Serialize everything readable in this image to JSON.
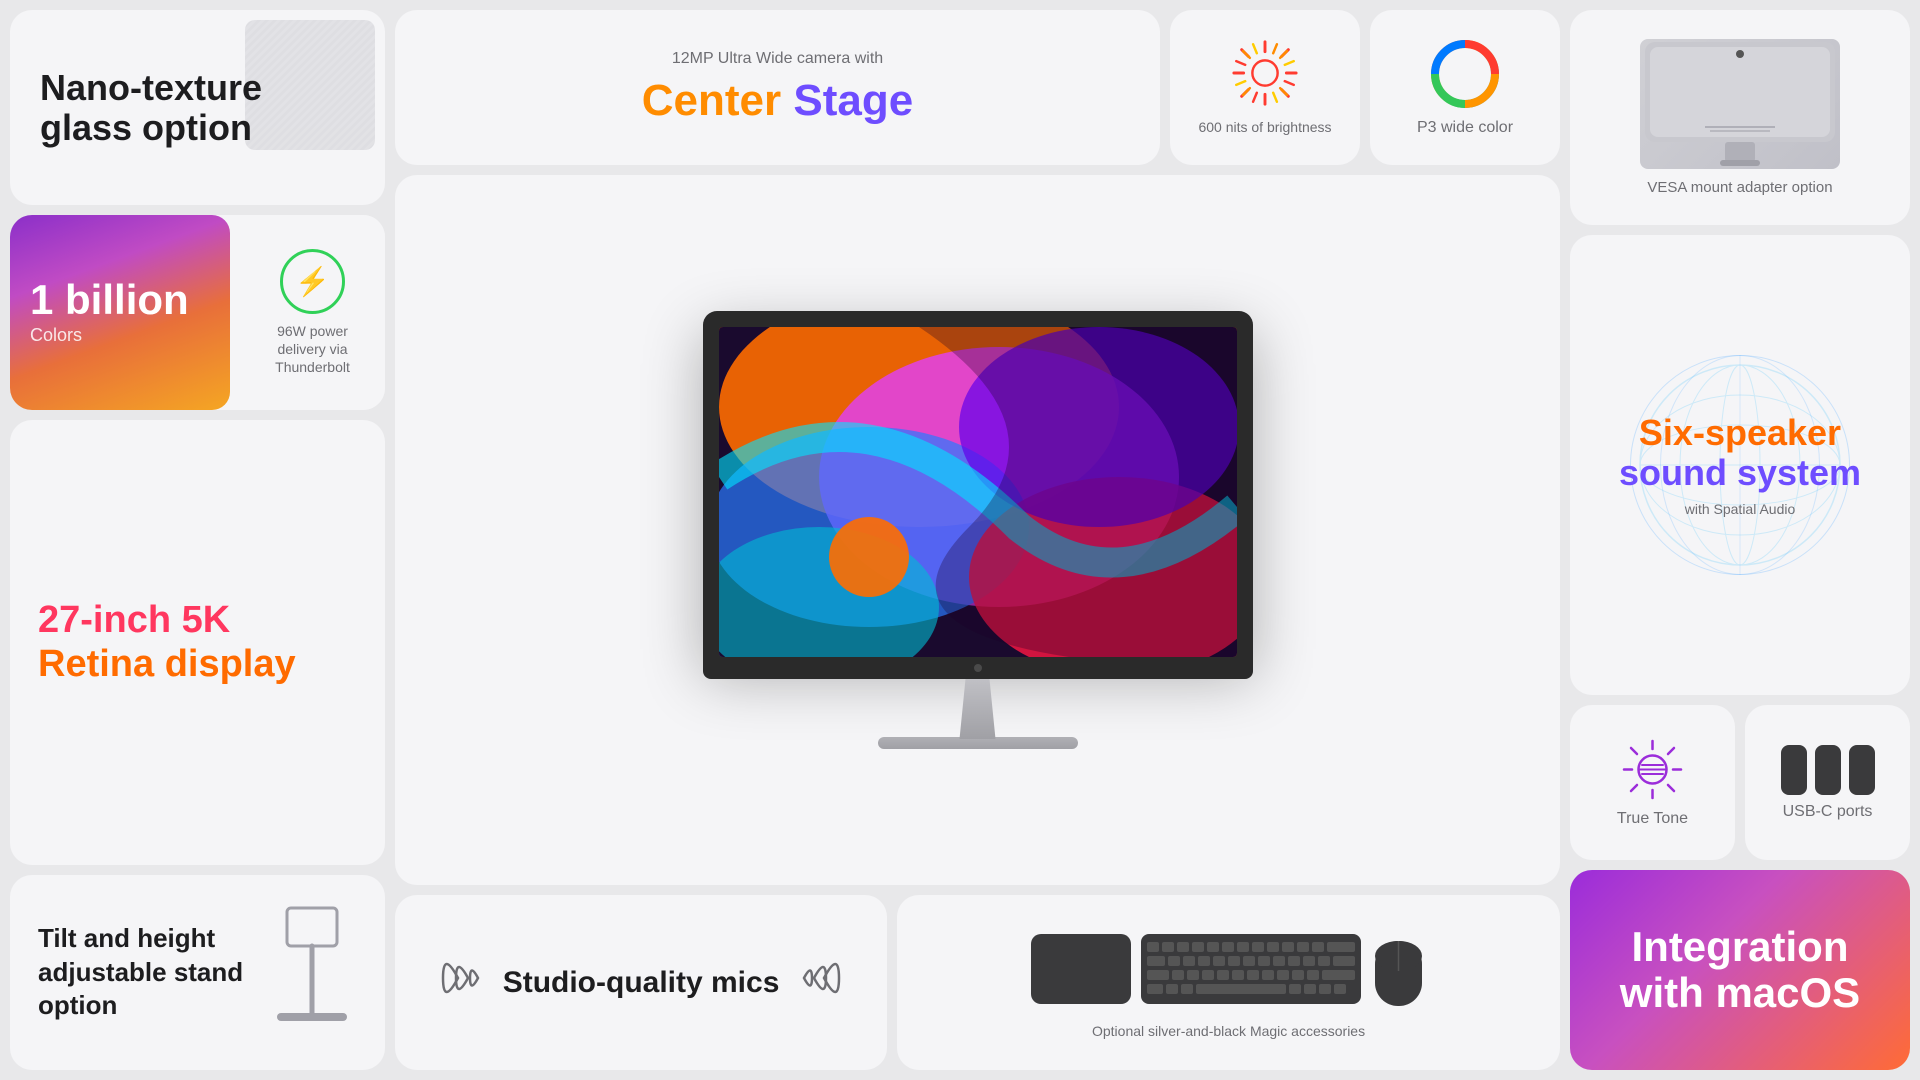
{
  "left": {
    "nano_texture": {
      "title": "Nano-texture glass option"
    },
    "billion": {
      "number": "1 billion",
      "label": "Colors",
      "power": "96W power delivery via Thunderbolt"
    },
    "retina": {
      "line1": "27-inch 5K",
      "line2": "Retina display"
    },
    "tilt": {
      "text": "Tilt and height adjustable stand option"
    }
  },
  "center": {
    "top": {
      "camera_label": "12MP Ultra Wide camera with",
      "center_stage": "Center Stage",
      "center": "Center",
      "stage": "Stage",
      "brightness": "600 nits of brightness",
      "p3": "P3 wide color"
    },
    "bottom": {
      "studio_mics": "Studio-quality mics",
      "accessories": "Optional silver-and-black Magic accessories"
    }
  },
  "right": {
    "vesa": {
      "text": "VESA mount adapter option"
    },
    "six_speaker": {
      "title_line1": "Six-speaker",
      "title_line2": "sound system",
      "spatial": "with Spatial Audio"
    },
    "true_tone": {
      "label": "True Tone"
    },
    "usb_c": {
      "label": "USB-C ports"
    },
    "integration": {
      "text": "Integration with macOS"
    }
  }
}
